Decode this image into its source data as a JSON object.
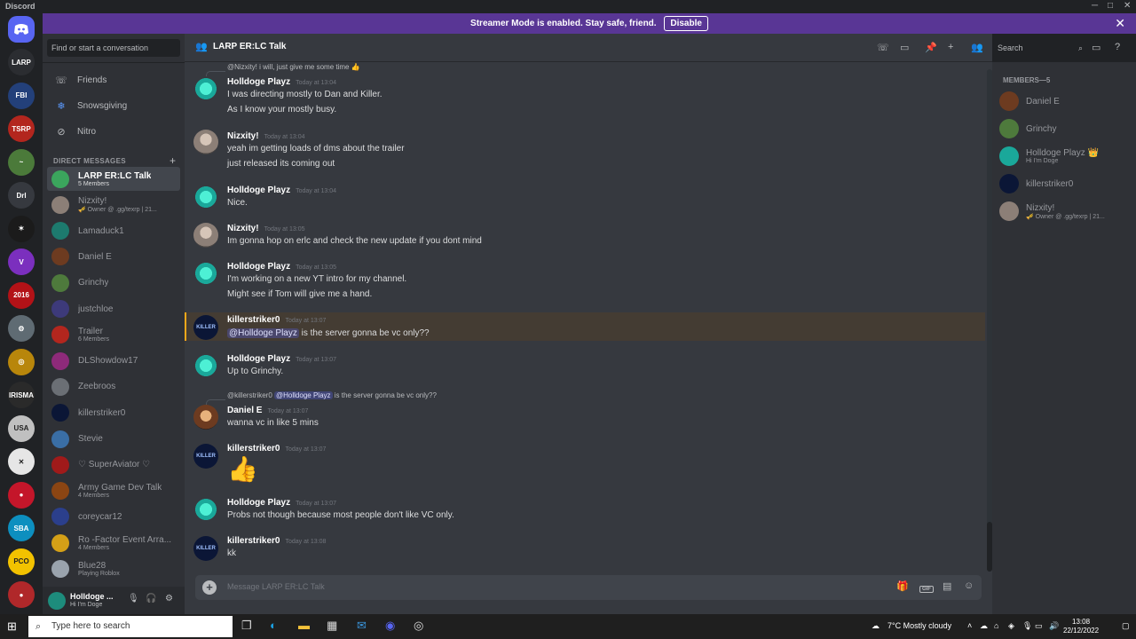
{
  "titlebar": {
    "app_name": "Discord",
    "minimize": "─",
    "maximize": "□",
    "close": "✕"
  },
  "banner": {
    "message": "Streamer Mode is enabled. Stay safe, friend.",
    "button": "Disable",
    "close": "✕"
  },
  "guilds": [
    {
      "label": "LARP",
      "color": "#2b2d31"
    },
    {
      "label": "FBI",
      "color": "#23407a"
    },
    {
      "label": "TSRP",
      "color": "#b3261e"
    },
    {
      "label": "~",
      "color": "#4b7a3a"
    },
    {
      "label": "Drl",
      "color": "#36393f"
    },
    {
      "label": "✶",
      "color": "#1b1b1b"
    },
    {
      "label": "V",
      "color": "#7b2fbe"
    },
    {
      "label": "2016",
      "color": "#b31217"
    },
    {
      "label": "⚙",
      "color": "#5f6b73"
    },
    {
      "label": "◎",
      "color": "#b8860b"
    },
    {
      "label": "IRISMA",
      "color": "#2a2a2a"
    },
    {
      "label": "USA",
      "color": "#c0c0c0"
    },
    {
      "label": "✕",
      "color": "#e6e6e6"
    },
    {
      "label": "●",
      "color": "#c4162a"
    },
    {
      "label": "SBA",
      "color": "#0d8fbf"
    },
    {
      "label": "PCO",
      "color": "#f2c200"
    },
    {
      "label": "●",
      "color": "#b0282a"
    }
  ],
  "sidebar": {
    "search_placeholder": "Find or start a conversation",
    "nav": [
      {
        "icon": "☏",
        "label": "Friends"
      },
      {
        "icon": "❄",
        "label": "Snowsgiving"
      },
      {
        "icon": "⊘",
        "label": "Nitro"
      }
    ],
    "dm_header": "DIRECT MESSAGES",
    "dm_add": "+",
    "dms": [
      {
        "name": "LARP ER:LC Talk",
        "sub": "5 Members",
        "active": true,
        "color": "#3ba55d"
      },
      {
        "name": "Nizxity!",
        "sub": "🎺 Owner @ .gg/texrp | 21...",
        "color": "#8c7f77"
      },
      {
        "name": "Lamaduck1",
        "sub": "",
        "color": "#1d7a6e"
      },
      {
        "name": "Daniel E",
        "sub": "",
        "color": "#6d3b20"
      },
      {
        "name": "Grinchy",
        "sub": "",
        "color": "#4e7a3c"
      },
      {
        "name": "justchloe",
        "sub": "",
        "color": "#3d3a7a"
      },
      {
        "name": "Trailer",
        "sub": "6 Members",
        "color": "#b3261e"
      },
      {
        "name": "DLShowdow17",
        "sub": "",
        "color": "#8e2a7a"
      },
      {
        "name": "Zeebroos",
        "sub": "",
        "color": "#6b6f75"
      },
      {
        "name": "killerstriker0",
        "sub": "",
        "color": "#0b1636"
      },
      {
        "name": "Stevie",
        "sub": "",
        "color": "#3a6ea5"
      },
      {
        "name": "♡ SuperAviator ♡",
        "sub": "",
        "color": "#a01a1a"
      },
      {
        "name": "Army Game Dev Talk",
        "sub": "4 Members",
        "color": "#8b4513"
      },
      {
        "name": "coreycar12",
        "sub": "",
        "color": "#2b3f8c"
      },
      {
        "name": "Ro -Factor Event Arra...",
        "sub": "4 Members",
        "color": "#d4a017"
      },
      {
        "name": "Blue28",
        "sub": "Playing Roblox",
        "color": "#9aa3ad"
      }
    ]
  },
  "user_panel": {
    "name": "Holldoge ...",
    "status": "Hi I'm Doge",
    "mic": "🎙",
    "headset": "🎧",
    "settings": "⚙"
  },
  "channel": {
    "icon": "👥",
    "title": "LARP ER:LC Talk",
    "search_placeholder": "Search"
  },
  "messages": {
    "reply1": {
      "author": "@Nizxity!",
      "text": "i will, just give me some time 👍"
    },
    "m1": {
      "author": "Holldoge Playz",
      "time": "Today at 13:04",
      "lines": [
        "I was directing mostly to Dan and Killer.",
        "As I know your mostly busy."
      ]
    },
    "m2": {
      "author": "Nizxity!",
      "time": "Today at 13:04",
      "lines": [
        "yeah im getting loads of dms about the trailer",
        "just released its coming out"
      ]
    },
    "m3": {
      "author": "Holldoge Playz",
      "time": "Today at 13:04",
      "lines": [
        "Nice."
      ]
    },
    "m4": {
      "author": "Nizxity!",
      "time": "Today at 13:05",
      "lines": [
        "Im gonna hop on erlc and check the new update if you dont mind"
      ]
    },
    "m5": {
      "author": "Holldoge Playz",
      "time": "Today at 13:05",
      "lines": [
        "I'm working on a new YT intro for my channel.",
        "Might see if Tom will give me a hand."
      ]
    },
    "m6": {
      "author": "killerstriker0",
      "time": "Today at 13:07",
      "mention": "@Holldoge Playz",
      "text": "is the server gonna be vc only??"
    },
    "m7": {
      "author": "Holldoge Playz",
      "time": "Today at 13:07",
      "lines": [
        "Up to Grinchy."
      ]
    },
    "reply2": {
      "author": "@killerstriker0",
      "mention": "@Holldoge Playz",
      "text": "is the server gonna be vc only??"
    },
    "m8": {
      "author": "Daniel E",
      "time": "Today at 13:07",
      "lines": [
        "wanna vc in like 5 mins"
      ]
    },
    "m9": {
      "author": "killerstriker0",
      "time": "Today at 13:07",
      "emoji": "👍"
    },
    "m10": {
      "author": "Holldoge Playz",
      "time": "Today at 13:07",
      "lines": [
        "Probs not though because most people don't like VC only."
      ]
    },
    "m11": {
      "author": "killerstriker0",
      "time": "Today at 13:08",
      "lines": [
        "kk"
      ]
    }
  },
  "composer": {
    "placeholder": "Message LARP ER:LC Talk",
    "gif": "GIF"
  },
  "members": {
    "header": "MEMBERS—5",
    "list": [
      {
        "name": "Daniel E",
        "sub": "",
        "color": "#6d3b20"
      },
      {
        "name": "Grinchy",
        "sub": "",
        "color": "#4e7a3c"
      },
      {
        "name": "Holldoge Playz 👑",
        "sub": "Hi I'm Doge",
        "color": "#1aa89a"
      },
      {
        "name": "killerstriker0",
        "sub": "",
        "color": "#0b1636"
      },
      {
        "name": "Nizxity!",
        "sub": "🎺 Owner @ .gg/texrp | 21...",
        "color": "#8c7f77"
      }
    ]
  },
  "taskbar": {
    "search_placeholder": "Type here to search",
    "weather": "7°C  Mostly cloudy",
    "time": "13:08",
    "date": "22/12/2022"
  }
}
